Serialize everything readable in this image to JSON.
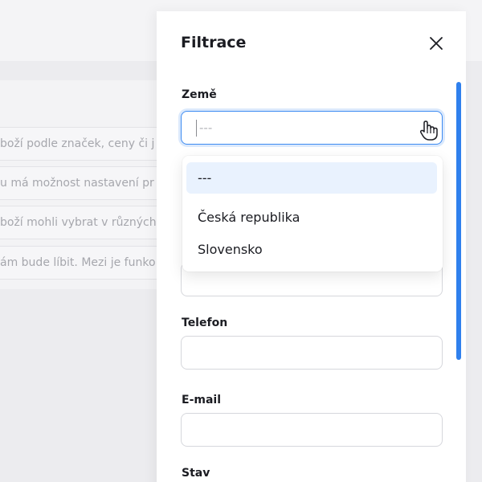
{
  "background": {
    "rows": [
      "boží podle značek, ceny či j",
      "u má možnost nastavení pr",
      "boží mohli vybrat v různých",
      "ám bude líbit. Mezi je funko"
    ]
  },
  "drawer": {
    "title": "Filtrace",
    "close_icon": "close-icon",
    "fields": {
      "country": {
        "label": "Země",
        "placeholder": "---"
      },
      "phone": {
        "label": "Telefon",
        "value": ""
      },
      "email": {
        "label": "E-mail",
        "value": ""
      },
      "status": {
        "label": "Stav"
      }
    },
    "dropdown": {
      "options": [
        "---",
        "Česká republika",
        "Slovensko"
      ],
      "selected": "---"
    }
  },
  "colors": {
    "accent": "#2f80ed",
    "selected_bg": "#e9f2fe"
  }
}
